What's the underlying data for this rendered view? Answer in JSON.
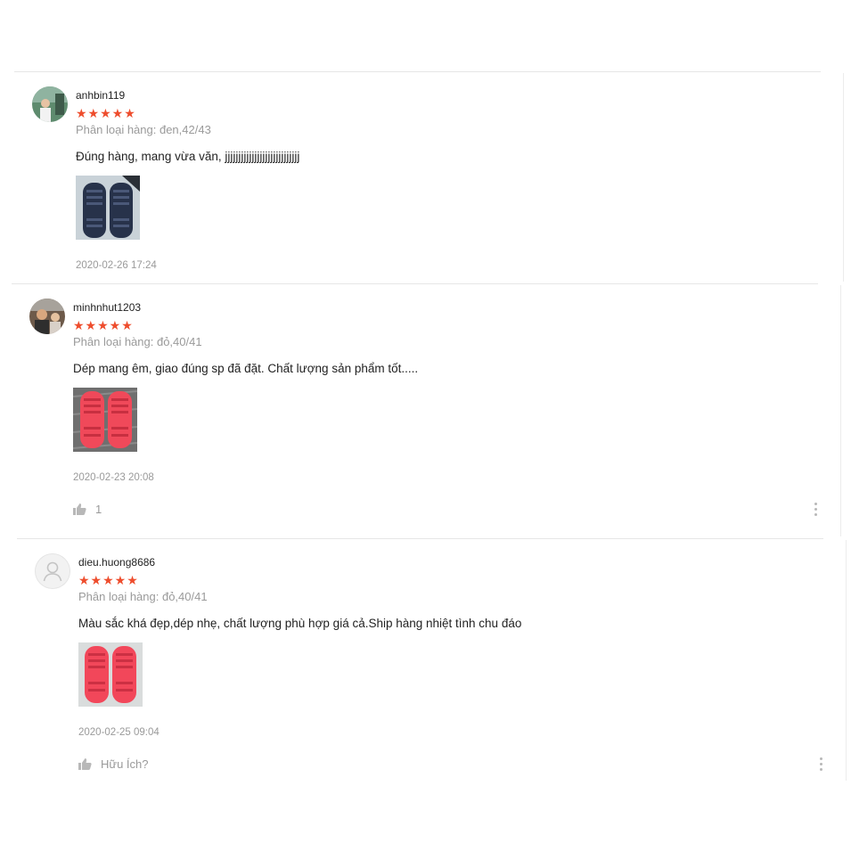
{
  "reviews": [
    {
      "username": "anhbin119",
      "stars": "★★★★★",
      "variant": "Phân loại hàng: đen,42/43",
      "comment": "Đúng hàng, mang vừa văn, jjjjjjjjjjjjjjjjjjjjjjjjjjjj",
      "date": "2020-02-26 17:24",
      "photo_icon": "slippers-navy-photo"
    },
    {
      "username": "minhnhut1203",
      "stars": "★★★★★",
      "variant": "Phân loại hàng: đỏ,40/41",
      "comment": "Dép mang êm, giao đúng sp đã đặt.  Chất lượng sản phẩm tốt.....",
      "date": "2020-02-23 20:08",
      "like_count": "1",
      "photo_icon": "slippers-red-photo"
    },
    {
      "username": "dieu.huong8686",
      "stars": "★★★★★",
      "variant": "Phân loại hàng: đỏ,40/41",
      "comment": "Màu sắc khá đẹp,dép nhẹ, chất lượng phù hợp giá cả.Ship hàng nhiệt tình chu đáo",
      "date": "2020-02-25 09:04",
      "helpful_label": "Hữu Ích?",
      "photo_icon": "slippers-red-photo"
    }
  ],
  "colors": {
    "star": "#ee4d2d",
    "muted": "#9a9a9a",
    "divider": "#e6e6e6"
  }
}
